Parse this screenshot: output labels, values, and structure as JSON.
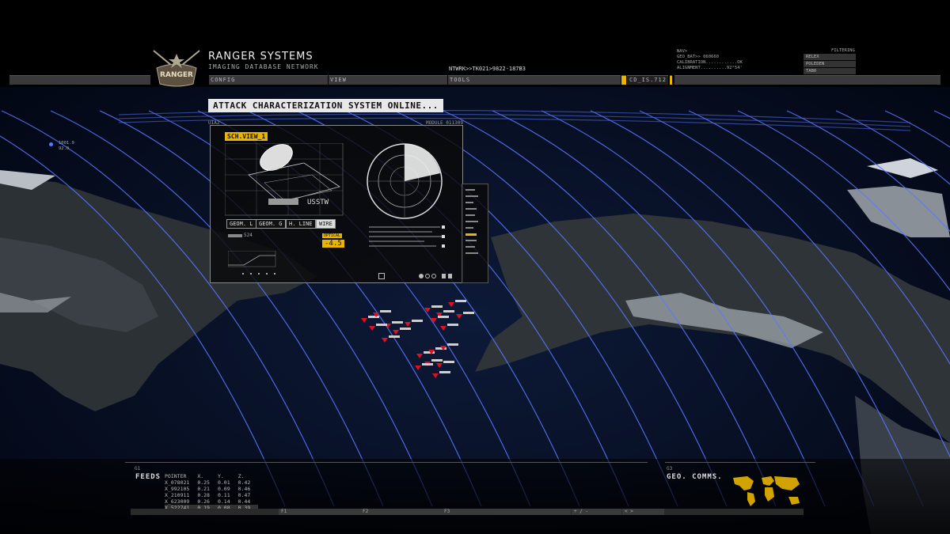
{
  "app": {
    "title": "RANGER SYSTEMS",
    "subtitle": "IMAGING DATABASE NETWORK",
    "logo_text": "RANGER"
  },
  "menu": {
    "items": [
      "CONFIG",
      "VIEW",
      "TOOLS"
    ],
    "code": "CD_IS.712"
  },
  "network_id": "NTWRK>>TK021>9822-187B3",
  "status": {
    "lines": [
      "NAV>",
      "GEO_BAT>> 060660",
      "CALIBRATION............OK",
      "ALIGNMENT..........92°54'"
    ]
  },
  "filtering": {
    "title": "FILTERING",
    "options": [
      "RELEX",
      "POLEDEN",
      "TAB0"
    ]
  },
  "banner": "ATTACK CHARACTERIZATION SYSTEM ONLINE...",
  "schematic": {
    "panel_id": "UIA2",
    "module": "MODULE_011309",
    "view_tag": "SCH.VIEW_1",
    "code": "USSTW",
    "buttons": [
      "GEOM. L",
      "GEOM. G",
      "H. LINE",
      "WIRE"
    ],
    "value_small": "524",
    "optical_label": "OPTICAL",
    "optical_value": "-4.5"
  },
  "sat": {
    "line1": "1001.9",
    "line2": "92.0"
  },
  "feeds": {
    "group": "G1",
    "label": "FEEDS",
    "columns": [
      "POINTER",
      "X.",
      "Y.",
      "Z."
    ],
    "rows": [
      [
        "X_078021",
        "0.25",
        "0.01",
        "0.42"
      ],
      [
        "X_992105",
        "0.21",
        "0.09",
        "0.46"
      ],
      [
        "X_210911",
        "0.28",
        "0.11",
        "0.47"
      ],
      [
        "X_623009",
        "0.26",
        "0.14",
        "0.44"
      ],
      [
        "X_522741",
        "0.19",
        "0.08",
        "0.39"
      ]
    ]
  },
  "geo": {
    "group": "G3",
    "label": "GEO. COMMS."
  },
  "fkeys": [
    "F1",
    "F2",
    "F3",
    "+ / -",
    "< >"
  ],
  "colors": {
    "accent": "#e8b500",
    "grid": "#5a78ff",
    "marker": "#e01020"
  }
}
